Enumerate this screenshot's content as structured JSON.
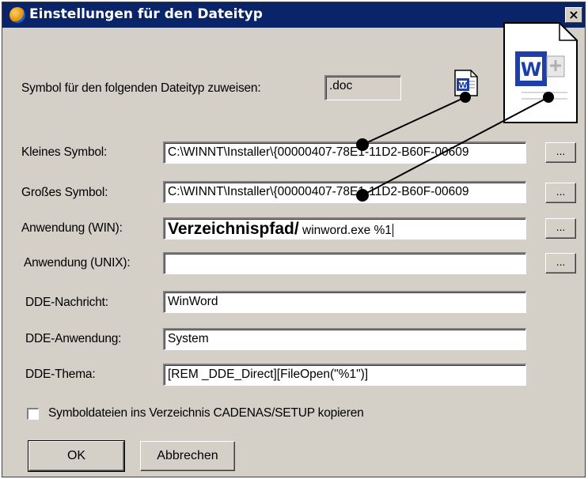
{
  "window": {
    "title": "Einstellungen für den Dateityp",
    "close_label": "×"
  },
  "filetype": {
    "label": "Symbol für den folgenden Dateityp zuweisen:",
    "value": ".doc"
  },
  "rows": {
    "small_icon": {
      "label": "Kleines Symbol:",
      "value": "C:\\WINNT\\Installer\\{00000407-78E1-11D2-B60F-00609"
    },
    "large_icon": {
      "label": "Großes Symbol:",
      "value": "C:\\WINNT\\Installer\\{00000407-78E1-11D2-B60F-00609"
    },
    "app_win": {
      "label": "Anwendung (WIN):",
      "value_prefix": "Verzeichnispfad/",
      "value_suffix": " winword.exe %1"
    },
    "app_unix": {
      "label": "Anwendung (UNIX):",
      "value": ""
    },
    "dde_message": {
      "label": "DDE-Nachricht:",
      "value": "WinWord"
    },
    "dde_app": {
      "label": "DDE-Anwendung:",
      "value": "System"
    },
    "dde_topic": {
      "label": "DDE-Thema:",
      "value": "[REM _DDE_Direct][FileOpen(\"%1\")]"
    }
  },
  "browse_label": "...",
  "copy_checkbox": {
    "label": "Symboldateien ins Verzeichnis CADENAS/SETUP kopieren",
    "checked": false
  },
  "buttons": {
    "ok": "OK",
    "cancel": "Abbrechen"
  },
  "icons": {
    "small": "word-document-small-icon",
    "large": "word-document-large-icon",
    "app": "settings-globe-icon"
  },
  "icon_text": {
    "small": "W",
    "large": "W"
  },
  "colors": {
    "titlebar": "#0a246a",
    "dialog": "#d4d0c8",
    "word_blue": "#1f3fa8"
  }
}
